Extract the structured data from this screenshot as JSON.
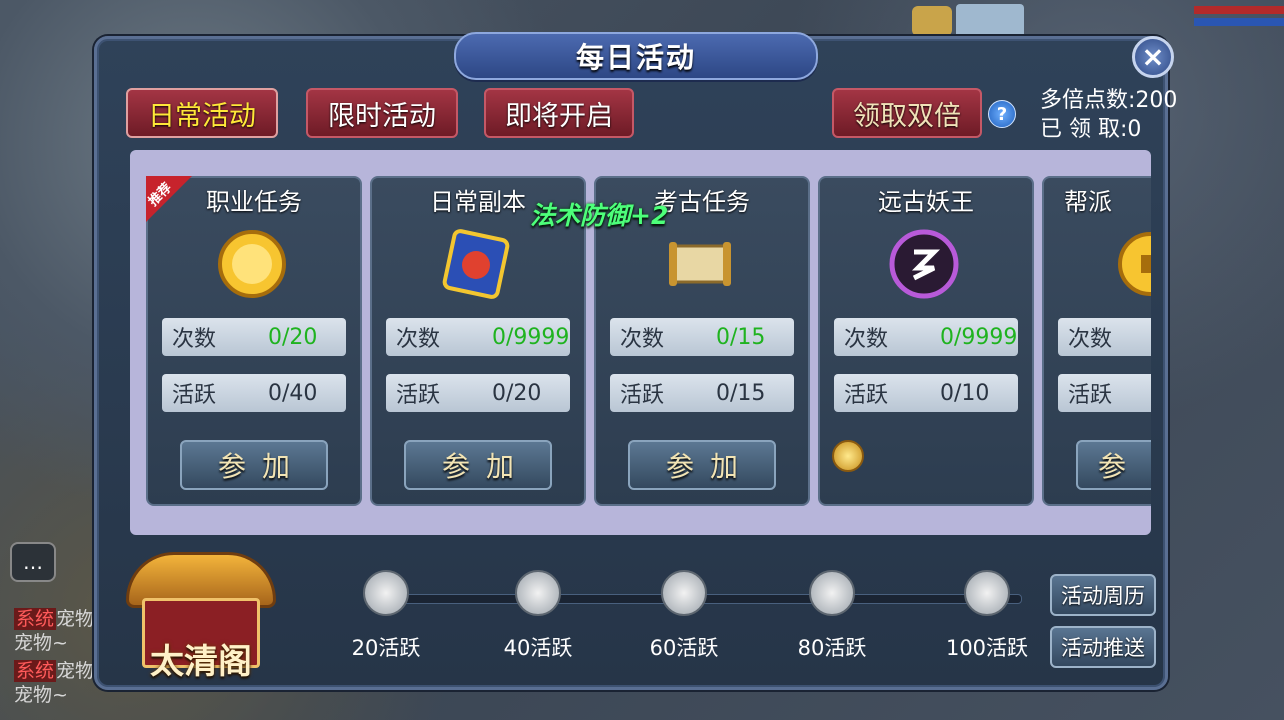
{
  "window": {
    "title": "每日活动"
  },
  "tabs": [
    {
      "label": "日常活动",
      "active": true
    },
    {
      "label": "限时活动",
      "active": false
    },
    {
      "label": "即将开启",
      "active": false
    }
  ],
  "claim_double_label": "领取双倍",
  "multiplier": {
    "points_label": "多倍点数:200",
    "claimed_label": "已 领 取:0"
  },
  "floating_text": "法术防御+2",
  "recommend_badge": "推荐",
  "cards": [
    {
      "title": "职业任务",
      "icon": "gold-coin-icon",
      "count_label": "次数",
      "count_value": "0/20",
      "active_label": "活跃",
      "active_value": "0/40",
      "button": "参加"
    },
    {
      "title": "日常副本",
      "icon": "dungeon-mask-icon",
      "count_label": "次数",
      "count_value": "0/9999",
      "active_label": "活跃",
      "active_value": "0/20",
      "button": "参加"
    },
    {
      "title": "考古任务",
      "icon": "scroll-map-icon",
      "count_label": "次数",
      "count_value": "0/15",
      "active_label": "活跃",
      "active_value": "0/15",
      "button": "参加"
    },
    {
      "title": "远古妖王",
      "icon": "demon-king-icon",
      "count_label": "次数",
      "count_value": "0/9999",
      "active_label": "活跃",
      "active_value": "0/10",
      "button": ""
    },
    {
      "title": "帮派",
      "icon": "guild-coin-icon",
      "count_label": "次数",
      "count_value": "",
      "active_label": "活跃",
      "active_value": "",
      "button": "参"
    }
  ],
  "milestones": [
    {
      "label": "20活跃"
    },
    {
      "label": "40活跃"
    },
    {
      "label": "60活跃"
    },
    {
      "label": "80活跃"
    },
    {
      "label": "100活跃"
    }
  ],
  "side_buttons": {
    "calendar": "活动周历",
    "push": "活动推送"
  },
  "taiqing": {
    "label": "太清阁"
  },
  "chat": {
    "sys_tag": "系统",
    "lines": [
      "宠物",
      "宠物~",
      "宠物",
      "宠物~"
    ]
  },
  "colors": {
    "count_value": "#1fb31f",
    "active_tab": "#ffe838",
    "tab_bg": "#8a2632"
  }
}
